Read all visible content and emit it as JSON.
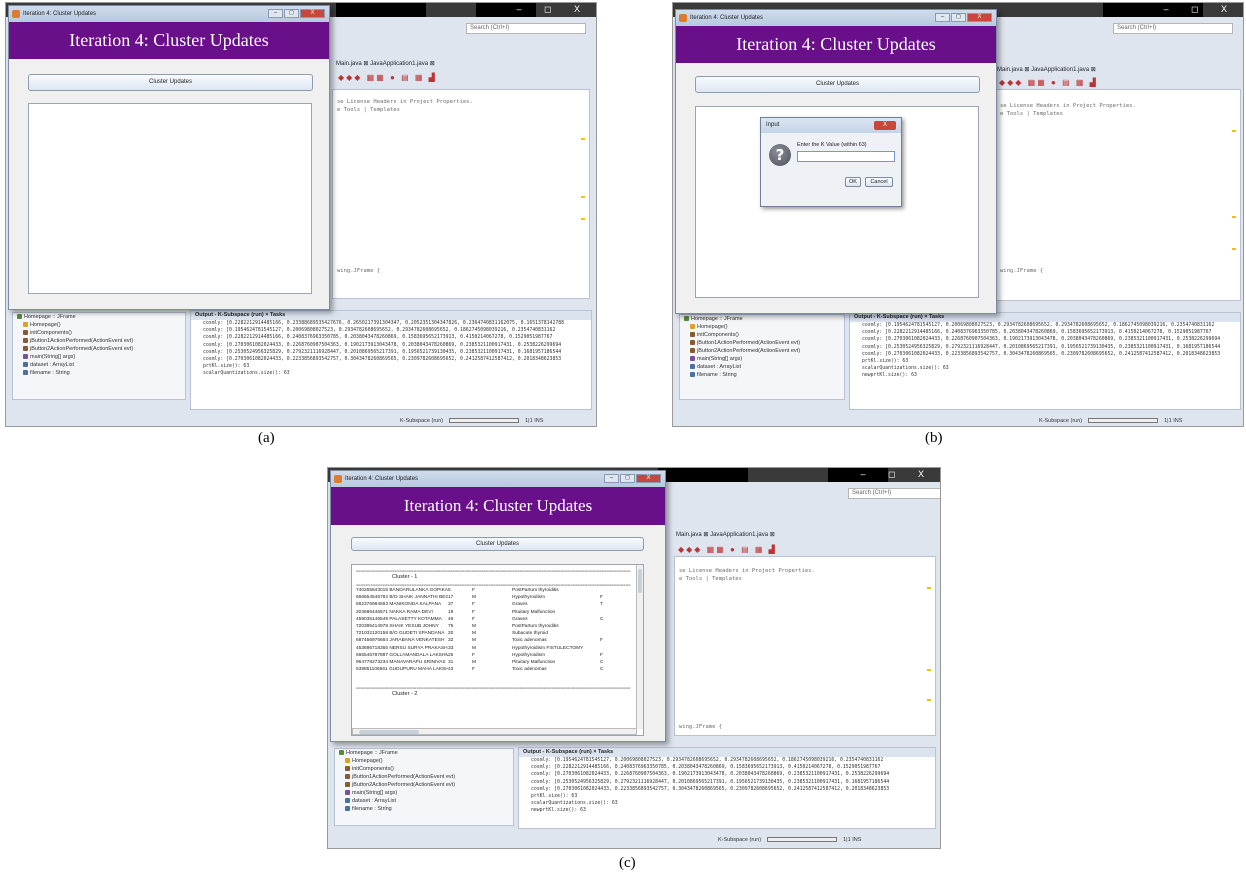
{
  "panels": [
    {
      "caption": "(a)",
      "frame_title": "Iteration 4: Cluster Updates",
      "banner": "Iteration 4: Cluster Updates",
      "button": "Cluster Updates"
    },
    {
      "caption": "(b)",
      "frame_title": "Iteration 4: Cluster Updates",
      "banner": "Iteration 4: Cluster Updates",
      "button": "Cluster Updates",
      "dialog": {
        "title": "Input",
        "close": "X",
        "message": "Enter the K Value (within 63)",
        "ok": "OK",
        "cancel": "Cancel"
      }
    },
    {
      "caption": "(c)",
      "frame_title": "Iteration 4: Cluster Updates",
      "banner": "Iteration 4: Cluster Updates",
      "button": "Cluster Updates",
      "cluster1_header": "Cluster - 1",
      "cluster2_header": "Cluster - 2",
      "rows": [
        {
          "name": "740265843015 BANDARULANKA GOPIKA",
          "age": "5",
          "sex": "F",
          "disease": "PostPartum thyroiditis",
          "extra": ""
        },
        {
          "name": "666654545782 B/O SHAIK JANNATHI BEGUM",
          "age": "17",
          "sex": "M",
          "disease": "Hypothyroidism",
          "extra": "F"
        },
        {
          "name": "562376984563 MANIKONDA KALPANA",
          "age": "37",
          "sex": "F",
          "disease": "Graves",
          "extra": "T"
        },
        {
          "name": "203686446571 NAKKA RAMA DEVI",
          "age": "19",
          "sex": "F",
          "disease": "Pituitary Malfunction",
          "extra": ""
        },
        {
          "name": "459035146549 PALASETTY KOTAMMA",
          "age": "49",
          "sex": "F",
          "disease": "Graves",
          "extra": "C"
        },
        {
          "name": "720395414978 SHAIK YESUB JOHNY",
          "age": "75",
          "sex": "M",
          "disease": "PostPartum thyroiditis",
          "extra": ""
        },
        {
          "name": "721032120158 B/O GUDETI SPANDANA",
          "age": "20",
          "sex": "M",
          "disease": "Subacute thyroid",
          "extra": ""
        },
        {
          "name": "687456976664 JARABANA VENKATESH",
          "age": "32",
          "sex": "M",
          "disease": "Toxic adenomas",
          "extra": "F"
        },
        {
          "name": "453696718365 NERSU SURYA PRAKASH",
          "age": "33",
          "sex": "M",
          "disease": "Hypothyroidism FISTULECTOMY",
          "extra": ""
        },
        {
          "name": "665546787887 GOLLAMANDALA LAKSHMI",
          "age": "25",
          "sex": "F",
          "disease": "Hypothyroidism",
          "extra": "F"
        },
        {
          "name": "964778273234 MANAVARAPU SRINIVAS",
          "age": "31",
          "sex": "M",
          "disease": "Pituitary Malfunction",
          "extra": "C"
        },
        {
          "name": "539851106561 GUDUPURU MAHA LAKSHMI",
          "age": "43",
          "sex": "F",
          "disease": "Toxic adenomas",
          "extra": "C"
        }
      ]
    }
  ],
  "ide": {
    "search_placeholder": "Search (Ctrl+I)",
    "tab1": "Main.java",
    "tab2": "JavaApplication1.java",
    "code_line1": "se License Headers in Project Properties.",
    "code_line2": "e Tools | Templates",
    "code_line3": "wing.JFrame {",
    "navigator": {
      "items": [
        "Homepage :: JFrame",
        "Homepage()",
        "initComponents()",
        "jButton1ActionPerformed(ActionEvent evt)",
        "jButton2ActionPerformed(ActionEvent evt)",
        "main(String[] args)",
        "dataset : ArrayList",
        "filename : String"
      ]
    },
    "output_title": "Output - K-Subspace (run)",
    "tasks_tab": "Tasks",
    "output_lines_a": [
      "cosmly: [0.2282212914485166, 0.23388689535427676, 0.2650217391304347, 0.2052351304347826, 0.2364740831162075, 0.1651378142788",
      "cosmly: [0.1954624781545127, 0.20069808027523, 0.2934782608695652, 0.2934782608695652, 0.1862745098039216, 0.2354740831162",
      "cosmly: [0.2282212914485166, 0.2408376963350785, 0.2038043478260869, 0.1583695652173913, 0.4150214067278, 0.1529051987767",
      "cosmly: [0.2703061082024433, 0.2268760907504363, 0.1902173913043478, 0.2038043478260869, 0.2385321100917431, 0.2538226299694",
      "cosmly: [0.2530524956325829, 0.2792321116928447, 0.2010869565217391, 0.1956521739130435, 0.2385321100917431, 0.1681957186544",
      "cosmly: [0.2703061082024433, 0.2233856893542757, 0.3043478260869565, 0.2309782608695652, 0.2412587412587412, 0.2018348623853",
      "prtKl.size(): 63",
      "scalarQuantizations.size(): 63"
    ],
    "output_lines_bc": [
      "cosmly: [0.1954624781545127, 0.20069808027523, 0.2934782608695652, 0.2934782608695652, 0.1862745098039216, 0.2354740831162",
      "cosmly: [0.2282212914485166, 0.2408376963350785, 0.2038043478260869, 0.1583695652173913, 0.4150214067278, 0.1529051987767",
      "cosmly: [0.2703061082024433, 0.2268760907504363, 0.1902173913043478, 0.2038043478260869, 0.2385321100917431, 0.2538226299694",
      "cosmly: [0.2530524956325829, 0.2792321116928447, 0.2010869565217391, 0.1956521739130435, 0.2385321100917431, 0.1681957186544",
      "cosmly: [0.2703061082024433, 0.2233856893542757, 0.3043478260869565, 0.2309782608695652, 0.2412587412587412, 0.2018348623853",
      "prtKl.size(): 63",
      "scalarQuantizations.size(): 63",
      "newprtKl.size(): 63"
    ],
    "status_label": "K-Subspace (run)",
    "status_state": "running...",
    "status_pos": "1|1",
    "status_ins": "INS"
  }
}
